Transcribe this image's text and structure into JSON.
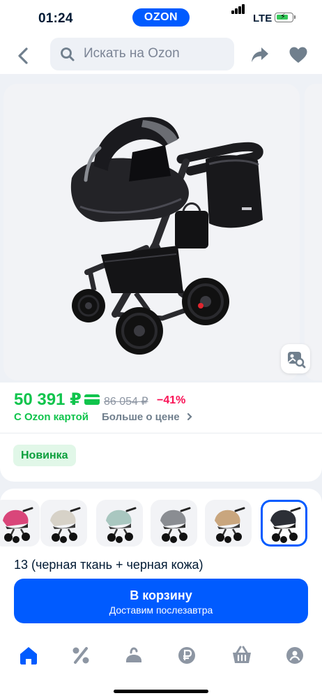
{
  "status_bar": {
    "time": "01:24",
    "brand": "OZON",
    "network": "LTE",
    "battery_level": 0.75
  },
  "search": {
    "placeholder": "Искать на Ozon"
  },
  "product": {
    "price": "50 391 ₽",
    "old_price": "86 054 ₽",
    "discount": "−41%",
    "card_caption": "С Ozon картой",
    "more_price_link": "Больше о цене",
    "badge": "Новинка",
    "variant_title": "13 (черная ткань + черная кожа)"
  },
  "variants": [
    {
      "color": "#d9467a",
      "accent": "#2a2a2a",
      "selected": false
    },
    {
      "color": "#d7d2c8",
      "accent": "#3a3a3a",
      "selected": false
    },
    {
      "color": "#a9c7c0",
      "accent": "#3a3a3a",
      "selected": false
    },
    {
      "color": "#8a8d92",
      "accent": "#303030",
      "selected": false
    },
    {
      "color": "#c9a67e",
      "accent": "#3a3a3a",
      "selected": false
    },
    {
      "color": "#2c2f36",
      "accent": "#1a1a1a",
      "selected": true
    }
  ],
  "cart": {
    "label": "В корзину",
    "sublabel": "Доставим послезавтра"
  },
  "tabs": [
    "home-icon",
    "percent-icon",
    "catalog-icon",
    "ruble-icon",
    "cart-icon",
    "profile-icon"
  ],
  "colors": {
    "accent": "#005bff",
    "price_green": "#10c44c",
    "discount_red": "#f91155"
  }
}
